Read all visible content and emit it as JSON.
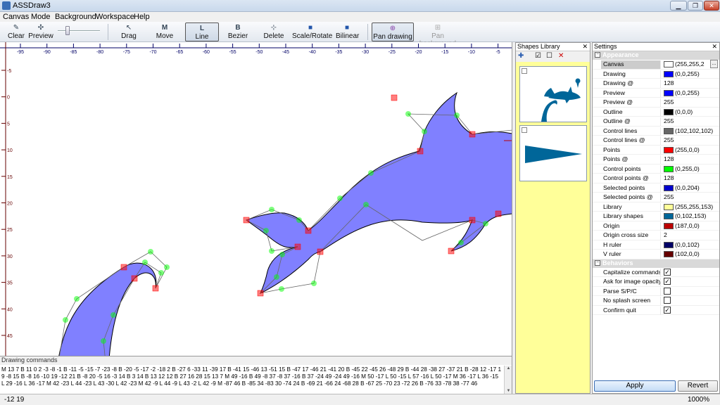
{
  "window": {
    "title": "ASSDraw3",
    "minimize": "▁",
    "restore": "❐",
    "close": "✕"
  },
  "menu": [
    "Canvas",
    "Mode",
    "Background",
    "Workspace",
    "Help"
  ],
  "toolbar": {
    "clear": "Clear",
    "preview": "Preview",
    "drag": "Drag",
    "move": "Move",
    "line": "Line",
    "bezier": "Bezier",
    "delete": "Delete",
    "scale_rotate": "Scale/Rotate",
    "bilinear": "Bilinear",
    "pan_drawing": "Pan drawing",
    "pan_background": "Pan background",
    "preview_slider_level": 0.2
  },
  "ruler": {
    "h_ticks": [
      "-95",
      "-90",
      "-85",
      "-80",
      "-75",
      "-70",
      "-65",
      "-60",
      "-55",
      "-50",
      "-45",
      "-40",
      "-35",
      "-30",
      "-25",
      "-20",
      "-15",
      "-10",
      "-5"
    ],
    "v_ticks": [
      "-5",
      "0",
      "5",
      "10",
      "15",
      "20",
      "25",
      "30",
      "35",
      "40",
      "45"
    ]
  },
  "commands": {
    "title": "Drawing commands",
    "text": "M 13 7 B 11 0 2 -3 -8 -1 B -11 -5 -15 -7 -23 -8 B -20 -5 -17 -2 -18 2 B -27 6 -33 11 -39 17 B -41 15 -46 13 -51 15 B -47 17 -46 21 -41 20 B -45 22 -45 26 -48 29 B -44 28 -38 27 -37 21 B -28 12 -17 19 -8 15 B -8 16 -10 19 -12 21 B -8 20 -5 16 -3 14 B 3 14 B 13 12 12 B 27 16 28 15 13 7 M 49 -16 B 49 -8 37 -8 37 -16 B 37 -24 49 -24 49 -16 M 50 -17 L 50 -15 L 57 -16 L 50 -17 M 36 -17 L 36 -15 L 29 -16 L 36 -17 M 42 -23 L 44 -23 L 43 -30 L 42 -23 M 42 -9 L 44 -9 L 43 -2 L 42 -9 M -87 46 B -85 34 -83 30 -74 24 B -69 21 -66 24 -68 28 B -67 25 -70 23 -72 26 B -76 33 -78 38 -77 46"
  },
  "status": {
    "coords": "-12  19",
    "zoom": "1000%"
  },
  "shapes_library": {
    "title": "Shapes Library",
    "close": "✕",
    "add": "✚",
    "check": "☑",
    "uncheck": "☐",
    "delete": "✕"
  },
  "settings": {
    "title": "Settings",
    "close": "✕",
    "appearance_label": "Appearance",
    "appearance": [
      {
        "name": "Canvas",
        "color": "#ffffff",
        "value": "(255,255,2"
      },
      {
        "name": "Drawing",
        "color": "#0000ff",
        "value": "(0,0,255)"
      },
      {
        "name": "Drawing @",
        "value": "128"
      },
      {
        "name": "Preview",
        "color": "#0000ff",
        "value": "(0,0,255)"
      },
      {
        "name": "Preview @",
        "value": "255"
      },
      {
        "name": "Outline",
        "color": "#000000",
        "value": "(0,0,0)"
      },
      {
        "name": "Outline @",
        "value": "255"
      },
      {
        "name": "Control lines",
        "color": "#666666",
        "value": "(102,102,102)"
      },
      {
        "name": "Control lines @",
        "value": "255"
      },
      {
        "name": "Points",
        "color": "#ff0000",
        "value": "(255,0,0)"
      },
      {
        "name": "Points @",
        "value": "128"
      },
      {
        "name": "Control points",
        "color": "#00ff00",
        "value": "(0,255,0)"
      },
      {
        "name": "Control points @",
        "value": "128"
      },
      {
        "name": "Selected points",
        "color": "#0000cc",
        "value": "(0,0,204)"
      },
      {
        "name": "Selected points @",
        "value": "255"
      },
      {
        "name": "Library",
        "color": "#ffff99",
        "value": "(255,255,153)"
      },
      {
        "name": "Library shapes",
        "color": "#006699",
        "value": "(0,102,153)"
      },
      {
        "name": "Origin",
        "color": "#bb0000",
        "value": "(187,0,0)"
      },
      {
        "name": "Origin cross size",
        "value": "2"
      },
      {
        "name": "H ruler",
        "color": "#000066",
        "value": "(0,0,102)"
      },
      {
        "name": "V ruler",
        "color": "#660000",
        "value": "(102,0,0)"
      }
    ],
    "behaviors_label": "Behaviors",
    "behaviors": [
      {
        "name": "Capitalize commands",
        "checked": true
      },
      {
        "name": "Ask for image opacity",
        "checked": true
      },
      {
        "name": "Parse S/P/C",
        "checked": false
      },
      {
        "name": "No splash screen",
        "checked": false
      },
      {
        "name": "Confirm quit",
        "checked": true
      }
    ],
    "apply": "Apply",
    "revert": "Revert",
    "more": "..."
  }
}
